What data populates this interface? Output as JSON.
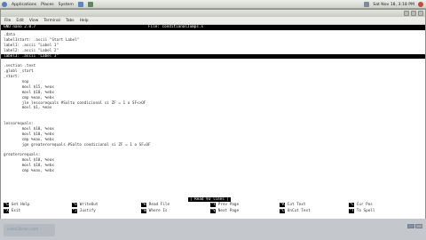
{
  "panel": {
    "applications": "Applications",
    "places": "Places",
    "system": "System",
    "clock": "Sat Nov 18,  3:18 PM"
  },
  "window": {
    "title": "",
    "menu": [
      "File",
      "Edit",
      "View",
      "Terminal",
      "Tabs",
      "Help"
    ]
  },
  "nano": {
    "version": "GNU nano 2.0.7",
    "filename": "File: conditionalJumps.s",
    "lines": [
      ".data",
      "label1start: .ascii \"Start Label\"",
      "label1: .ascii \"Label 1\"",
      "label2: .ascii \"Label 2\"",
      "label3: .ascii \"Label 3\"",
      "",
      ".section .text",
      ".globl _start",
      "_start:",
      "        nop",
      "        movl $15, %eax",
      "        movl $10, %ebx",
      "        cmp %eax, %ebx",
      "        jle lessorequals #Salto condicional si ZF = 1 o SF<>OF",
      "        movl $1, %eax",
      "",
      "",
      "lessorequals:",
      "        movl $10, %eax",
      "        movl $10, %ebx",
      "        cmp %eax, %ebx",
      "        jge greaterorequals #Salto condicional si ZF = 1 o SF=OF",
      "",
      "greaterorequals:",
      "        movl $10, %eax",
      "        movl $10, %ebx",
      "        cmp %eax, %ebx"
    ],
    "highlight_line": 4,
    "status": "[ Read 93 lines ]",
    "shortcuts": [
      {
        "key": "^G",
        "label": "Get Help"
      },
      {
        "key": "^O",
        "label": "WriteOut"
      },
      {
        "key": "^R",
        "label": "Read File"
      },
      {
        "key": "^Y",
        "label": "Prev Page"
      },
      {
        "key": "^K",
        "label": "Cut Text"
      },
      {
        "key": "^C",
        "label": "Cur Pos"
      },
      {
        "key": "^X",
        "label": "Exit"
      },
      {
        "key": "^J",
        "label": "Justify"
      },
      {
        "key": "^W",
        "label": "Where Is"
      },
      {
        "key": "^V",
        "label": "Next Page"
      },
      {
        "key": "^U",
        "label": "UnCut Text"
      },
      {
        "key": "^T",
        "label": "To Spell"
      }
    ]
  },
  "taskbar": {
    "watermark": "video2brain.com"
  }
}
